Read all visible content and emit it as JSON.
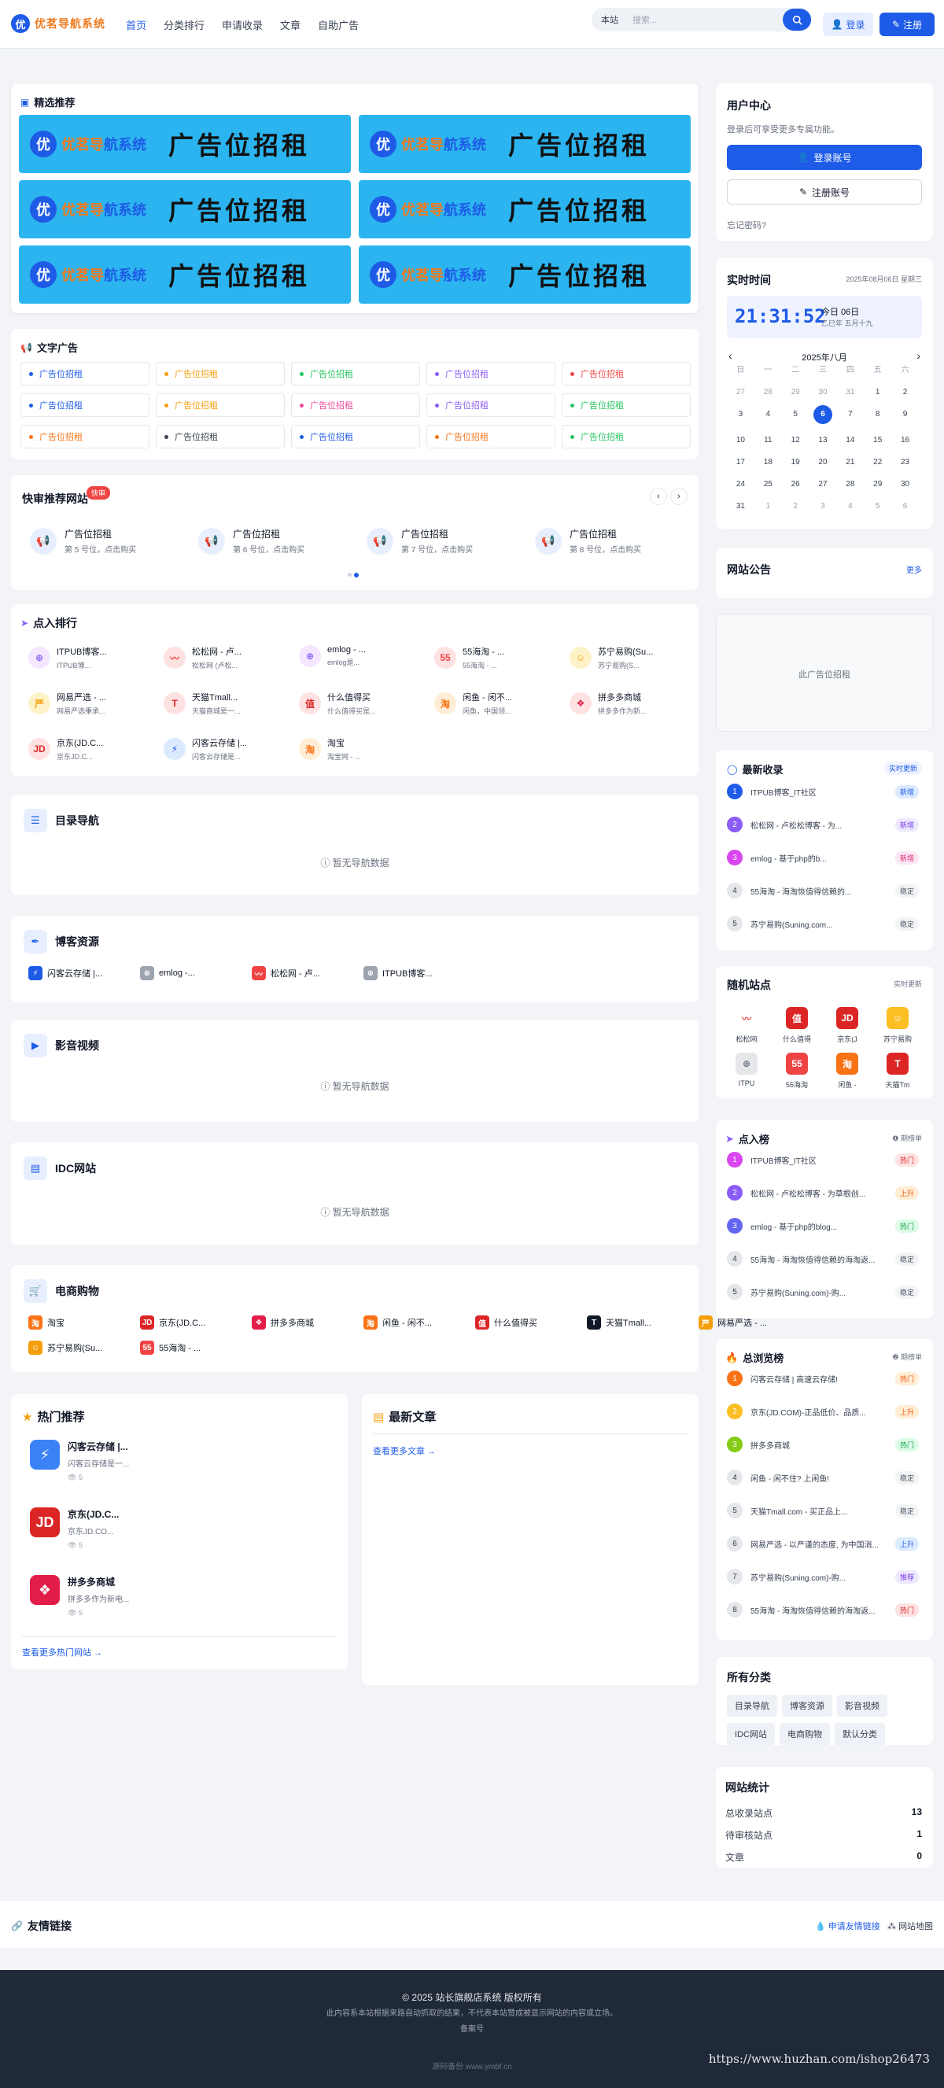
{
  "header": {
    "logo_badge": "优",
    "logo_text": "优茗导航系统",
    "nav": [
      "首页",
      "分类排行",
      "申请收录",
      "文章",
      "自助广告"
    ],
    "search_scope": "本站",
    "search_placeholder": "搜索...",
    "login": "登录",
    "register": "注册"
  },
  "featured": {
    "title": "精选推荐",
    "logo_badge": "优",
    "ad_name_a": "优茗导",
    "ad_name_b": "航",
    "ad_name_c": "系统",
    "ad_text": "广告位招租"
  },
  "text_ads": {
    "title": "文字广告",
    "items": [
      {
        "label": "广告位招租",
        "color": "#1e5be6"
      },
      {
        "label": "广告位招租",
        "color": "#f59e0b"
      },
      {
        "label": "广告位招租",
        "color": "#22c55e"
      },
      {
        "label": "广告位招租",
        "color": "#8b5cf6"
      },
      {
        "label": "广告位招租",
        "color": "#ef4444"
      },
      {
        "label": "广告位招租",
        "color": "#1e5be6"
      },
      {
        "label": "广告位招租",
        "color": "#f59e0b"
      },
      {
        "label": "广告位招租",
        "color": "#ec4899"
      },
      {
        "label": "广告位招租",
        "color": "#8b5cf6"
      },
      {
        "label": "广告位招租",
        "color": "#22c55e"
      },
      {
        "label": "广告位招租",
        "color": "#f97316"
      },
      {
        "label": "广告位招租",
        "color": "#374151"
      },
      {
        "label": "广告位招租",
        "color": "#1e5be6"
      },
      {
        "label": "广告位招租",
        "color": "#f97316"
      },
      {
        "label": "广告位招租",
        "color": "#22c55e"
      }
    ]
  },
  "quick_review": {
    "title": "快审推荐网站",
    "badge": "快审",
    "items": [
      {
        "title": "广告位招租",
        "sub": "第 5 号位，点击购买"
      },
      {
        "title": "广告位招租",
        "sub": "第 6 号位，点击购买"
      },
      {
        "title": "广告位招租",
        "sub": "第 7 号位，点击购买"
      },
      {
        "title": "广告位招租",
        "sub": "第 8 号位，点击购买"
      }
    ]
  },
  "click_rank": {
    "title": "点入排行",
    "items": [
      {
        "name": "ITPUB博客...",
        "desc": "ITPUB博...",
        "icon": "⊕",
        "bg": "#f3e8ff",
        "fg": "#8b5cf6"
      },
      {
        "name": "松松网 - 卢...",
        "desc": "松松网 (卢松...",
        "icon": "〰",
        "bg": "#fee2e2",
        "fg": "#ef4444"
      },
      {
        "name": "emlog - ...",
        "desc": "emlog是...",
        "icon": "⊕",
        "bg": "#f3e8ff",
        "fg": "#8b5cf6"
      },
      {
        "name": "55海淘 - ...",
        "desc": "55海淘 - ...",
        "icon": "55",
        "bg": "#fee2e2",
        "fg": "#ef4444"
      },
      {
        "name": "苏宁易购(Su...",
        "desc": "苏宁易购(S...",
        "icon": "☺",
        "bg": "#fef3c7",
        "fg": "#f59e0b"
      },
      {
        "name": "网易严选 - ...",
        "desc": "网易严选秉承...",
        "icon": "严",
        "bg": "#fef3c7",
        "fg": "#f59e0b"
      },
      {
        "name": "天猫Tmall...",
        "desc": "天猫商城是一...",
        "icon": "T",
        "bg": "#fee2e2",
        "fg": "#dc2626"
      },
      {
        "name": "什么值得买",
        "desc": "什么值得买是...",
        "icon": "值",
        "bg": "#fee2e2",
        "fg": "#dc2626"
      },
      {
        "name": "闲鱼 - 闲不...",
        "desc": "闲鱼，中国领...",
        "icon": "淘",
        "bg": "#ffedd5",
        "fg": "#f97316"
      },
      {
        "name": "拼多多商城",
        "desc": "拼多多作为新...",
        "icon": "❖",
        "bg": "#fee2e2",
        "fg": "#e11d48"
      },
      {
        "name": "京东(JD.C...",
        "desc": "京东JD.C...",
        "icon": "JD",
        "bg": "#fee2e2",
        "fg": "#dc2626"
      },
      {
        "name": "闪客云存储 |...",
        "desc": "闪客云存储是...",
        "icon": "⚡",
        "bg": "#dbeafe",
        "fg": "#1e5be6"
      },
      {
        "name": "淘宝",
        "desc": "淘宝网 - ...",
        "icon": "淘",
        "bg": "#ffedd5",
        "fg": "#f97316"
      }
    ]
  },
  "cat_nav": {
    "title": "目录导航",
    "empty": "暂无导航数据"
  },
  "blog": {
    "title": "博客资源",
    "sites": [
      {
        "name": "闪客云存储 |...",
        "icon": "⚡",
        "bg": "#1e5be6"
      },
      {
        "name": "emlog -...",
        "icon": "⊕",
        "bg": "#9ca3af"
      },
      {
        "name": "松松网 - 卢...",
        "icon": "〰",
        "bg": "#ef4444"
      },
      {
        "name": "ITPUB博客...",
        "icon": "⊕",
        "bg": "#9ca3af"
      }
    ]
  },
  "video": {
    "title": "影音视频",
    "empty": "暂无导航数据"
  },
  "idc": {
    "title": "IDC网站",
    "empty": "暂无导航数据"
  },
  "shop": {
    "title": "电商购物",
    "sites": [
      {
        "name": "淘宝",
        "icon": "淘",
        "bg": "#f97316"
      },
      {
        "name": "京东(JD.C...",
        "icon": "JD",
        "bg": "#dc2626"
      },
      {
        "name": "拼多多商城",
        "icon": "❖",
        "bg": "#e11d48"
      },
      {
        "name": "闲鱼 - 闲不...",
        "icon": "淘",
        "bg": "#f97316"
      },
      {
        "name": "什么值得买",
        "icon": "值",
        "bg": "#dc2626"
      },
      {
        "name": "天猫Tmall...",
        "icon": "T",
        "bg": "#111827"
      },
      {
        "name": "网易严选 - ...",
        "icon": "严",
        "bg": "#f59e0b"
      },
      {
        "name": "苏宁易购(Su...",
        "icon": "☺",
        "bg": "#f59e0b"
      },
      {
        "name": "55海淘 - ...",
        "icon": "55",
        "bg": "#ef4444"
      }
    ]
  },
  "hot": {
    "title": "热门推荐",
    "items": [
      {
        "name": "闪客云存储 |...",
        "desc": "闪客云存储是一...",
        "views": "5",
        "icon": "⚡",
        "bg": "#3b82f6"
      },
      {
        "name": "京东(JD.C...",
        "desc": "京东JD.CO...",
        "views": "5",
        "icon": "JD",
        "bg": "#dc2626"
      },
      {
        "name": "拼多多商城",
        "desc": "拼多多作为新电...",
        "views": "5",
        "icon": "❖",
        "bg": "#e11d48"
      }
    ],
    "more": "查看更多热门网站 →"
  },
  "articles": {
    "title": "最新文章",
    "more": "查看更多文章 →"
  },
  "user": {
    "title": "用户中心",
    "desc": "登录后可享受更多专属功能。",
    "login": "登录账号",
    "register": "注册账号",
    "forgot": "忘记密码?"
  },
  "clock": {
    "title": "实时时间",
    "date": "2025年08月06日 星期三",
    "time": "21:31:52",
    "today": "今日 06日",
    "lunar": "乙巳年 五月十九",
    "month": "2025年八月",
    "weekdays": [
      "日",
      "一",
      "二",
      "三",
      "四",
      "五",
      "六"
    ],
    "days": [
      [
        "27",
        0
      ],
      [
        "28",
        0
      ],
      [
        "29",
        0
      ],
      [
        "30",
        0
      ],
      [
        "31",
        0
      ],
      [
        "1",
        1
      ],
      [
        "2",
        1
      ],
      [
        "3",
        1
      ],
      [
        "4",
        1
      ],
      [
        "5",
        1
      ],
      [
        "6",
        2
      ],
      [
        "7",
        1
      ],
      [
        "8",
        1
      ],
      [
        "9",
        1
      ],
      [
        "10",
        1
      ],
      [
        "11",
        1
      ],
      [
        "12",
        1
      ],
      [
        "13",
        1
      ],
      [
        "14",
        1
      ],
      [
        "15",
        1
      ],
      [
        "16",
        1
      ],
      [
        "17",
        1
      ],
      [
        "18",
        1
      ],
      [
        "19",
        1
      ],
      [
        "20",
        1
      ],
      [
        "21",
        1
      ],
      [
        "22",
        1
      ],
      [
        "23",
        1
      ],
      [
        "24",
        1
      ],
      [
        "25",
        1
      ],
      [
        "26",
        1
      ],
      [
        "27",
        1
      ],
      [
        "28",
        1
      ],
      [
        "29",
        1
      ],
      [
        "30",
        1
      ],
      [
        "31",
        1
      ],
      [
        "1",
        0
      ],
      [
        "2",
        0
      ],
      [
        "3",
        0
      ],
      [
        "4",
        0
      ],
      [
        "5",
        0
      ],
      [
        "6",
        0
      ]
    ]
  },
  "notice": {
    "title": "网站公告",
    "more": "更多"
  },
  "sidead": {
    "text": "此广告位招租"
  },
  "latest": {
    "title": "最新收录",
    "live": "实时更新",
    "items": [
      {
        "name": "ITPUB博客_IT社区",
        "tag": "新增",
        "c": "#1e5be6",
        "tb": "#dbeafe",
        "tf": "#1e5be6"
      },
      {
        "name": "松松网 - 卢松松博客 - 为...",
        "tag": "新增",
        "c": "#8b5cf6",
        "tb": "#ede9fe",
        "tf": "#7c3aed"
      },
      {
        "name": "emlog - 基于php的b...",
        "tag": "新增",
        "c": "#d946ef",
        "tb": "#fce7f3",
        "tf": "#db2777"
      },
      {
        "name": "55海淘 - 海淘恢值得信赖的...",
        "tag": "稳定",
        "c": "#e5e7eb",
        "tb": "#f3f4f6",
        "tf": "#4b5563"
      },
      {
        "name": "苏宁易购(Suning.com...",
        "tag": "稳定",
        "c": "#e5e7eb",
        "tb": "#f3f4f6",
        "tf": "#4b5563"
      }
    ]
  },
  "random": {
    "title": "随机站点",
    "live": "实时更新",
    "items": [
      {
        "name": "松松网",
        "icon": "〰",
        "bg": "#fff",
        "fg": "#ef4444"
      },
      {
        "name": "什么值得",
        "icon": "值",
        "bg": "#dc2626",
        "fg": "#fff"
      },
      {
        "name": "京东(J",
        "icon": "JD",
        "bg": "#dc2626",
        "fg": "#fff"
      },
      {
        "name": "苏宁易购",
        "icon": "☺",
        "bg": "#fbbf24",
        "fg": "#fff"
      },
      {
        "name": "ITPU",
        "icon": "⊕",
        "bg": "#e5e7eb",
        "fg": "#6b7280"
      },
      {
        "name": "55海淘",
        "icon": "55",
        "bg": "#ef4444",
        "fg": "#fff"
      },
      {
        "name": "闲鱼 -",
        "icon": "淘",
        "bg": "#f97316",
        "fg": "#fff"
      },
      {
        "name": "天猫Tm",
        "icon": "T",
        "bg": "#dc2626",
        "fg": "#fff"
      }
    ]
  },
  "click_board": {
    "title": "点入榜",
    "note": "❶ 期榜单",
    "items": [
      {
        "name": "ITPUB博客_IT社区",
        "tag": "热门",
        "c": "#d946ef",
        "tb": "#fee2e2",
        "tf": "#dc2626"
      },
      {
        "name": "松松网 - 卢松松博客 - 为草根创...",
        "tag": "上升",
        "c": "#8b5cf6",
        "tb": "#ffedd5",
        "tf": "#ea580c"
      },
      {
        "name": "emlog - 基于php的blog...",
        "tag": "热门",
        "c": "#6366f1",
        "tb": "#dcfce7",
        "tf": "#16a34a"
      },
      {
        "name": "55海淘 - 海淘恢值得信赖的海淘返...",
        "tag": "稳定",
        "c": "#e5e7eb",
        "tb": "#f3f4f6",
        "tf": "#4b5563"
      },
      {
        "name": "苏宁易购(Suning.com)-购...",
        "tag": "稳定",
        "c": "#e5e7eb",
        "tb": "#f3f4f6",
        "tf": "#4b5563"
      }
    ]
  },
  "total_board": {
    "title": "总浏览榜",
    "note": "❷ 期榜单",
    "items": [
      {
        "name": "闪客云存储 | 高速云存储!",
        "tag": "热门",
        "c": "#f97316",
        "tb": "#ffedd5",
        "tf": "#ea580c"
      },
      {
        "name": "京东(JD.COM)-正品低价、品质...",
        "tag": "上升",
        "c": "#fbbf24",
        "tb": "#ffedd5",
        "tf": "#ea580c"
      },
      {
        "name": "拼多多商城",
        "tag": "热门",
        "c": "#84cc16",
        "tb": "#dcfce7",
        "tf": "#16a34a"
      },
      {
        "name": "闲鱼 - 闲不住? 上闲鱼!",
        "tag": "稳定",
        "c": "#e5e7eb",
        "tb": "#f3f4f6",
        "tf": "#4b5563"
      },
      {
        "name": "天猫Tmall.com - 买正品上...",
        "tag": "稳定",
        "c": "#e5e7eb",
        "tb": "#f3f4f6",
        "tf": "#4b5563"
      },
      {
        "name": "网易严选 - 以严谨的态度, 为中国消...",
        "tag": "上升",
        "c": "#e5e7eb",
        "tb": "#dbeafe",
        "tf": "#1e5be6"
      },
      {
        "name": "苏宁易购(Suning.com)-购...",
        "tag": "推荐",
        "c": "#e5e7eb",
        "tb": "#ede9fe",
        "tf": "#7c3aed"
      },
      {
        "name": "55海淘 - 海淘恢值得信赖的海淘返...",
        "tag": "热门",
        "c": "#e5e7eb",
        "tb": "#fee2e2",
        "tf": "#dc2626"
      }
    ]
  },
  "categories": {
    "title": "所有分类",
    "items": [
      "目录导航",
      "博客资源",
      "影音视频",
      "IDC网站",
      "电商购物",
      "默认分类"
    ]
  },
  "stats": {
    "title": "网站统计",
    "rows": [
      {
        "label": "总收录站点",
        "value": "13"
      },
      {
        "label": "待审核站点",
        "value": "1"
      },
      {
        "label": "文章",
        "value": "0"
      }
    ]
  },
  "links": {
    "title": "友情链接",
    "apply": "申请友情链接",
    "sitemap": "网站地图"
  },
  "footer": {
    "copy": "© 2025 站长旗舰店系统 版权所有",
    "disclaimer": "此内容系本站根据来路自动抓取的结果，不代表本站赞成被显示网站的内容或立场。",
    "beian": "备案号",
    "powered": "源码备份 www.ymbf.cn",
    "watermark": "https://www.huzhan.com/ishop26473"
  }
}
